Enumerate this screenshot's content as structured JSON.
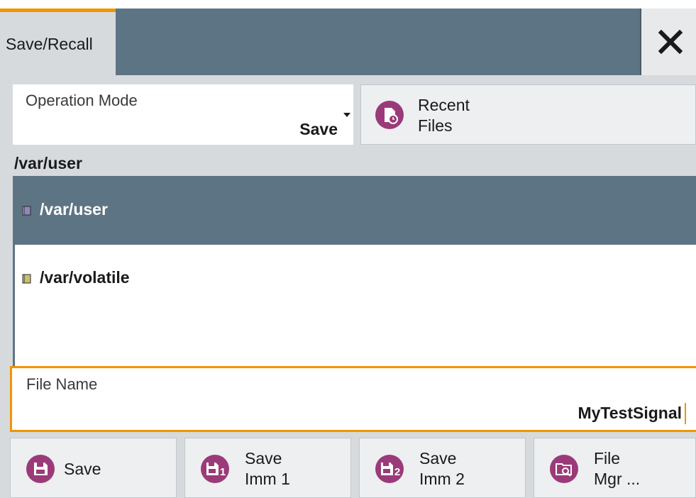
{
  "window": {
    "tab_title": "Save/Recall",
    "close_icon": "close-icon"
  },
  "operation_mode": {
    "label": "Operation Mode",
    "value": "Save"
  },
  "recent_files": {
    "line1": "Recent",
    "line2": "Files",
    "icon": "recent-files-icon"
  },
  "current_path": "/var/user",
  "directory_list": [
    {
      "label": "/var/user",
      "selected": true
    },
    {
      "label": "/var/volatile",
      "selected": false
    }
  ],
  "file_name": {
    "label": "File Name",
    "value": "MyTestSignal"
  },
  "buttons": {
    "save": {
      "label": "Save",
      "icon": "save-icon"
    },
    "save_imm1": {
      "line1": "Save",
      "line2": "Imm 1",
      "icon": "save-imm-1-icon"
    },
    "save_imm2": {
      "line1": "Save",
      "line2": "Imm 2",
      "icon": "save-imm-2-icon"
    },
    "file_mgr": {
      "line1": "File",
      "line2": "Mgr ...",
      "icon": "file-manager-icon"
    }
  },
  "colors": {
    "accent_orange": "#f29400",
    "titlebar": "#5d7484",
    "icon_purple": "#9b3a79"
  }
}
